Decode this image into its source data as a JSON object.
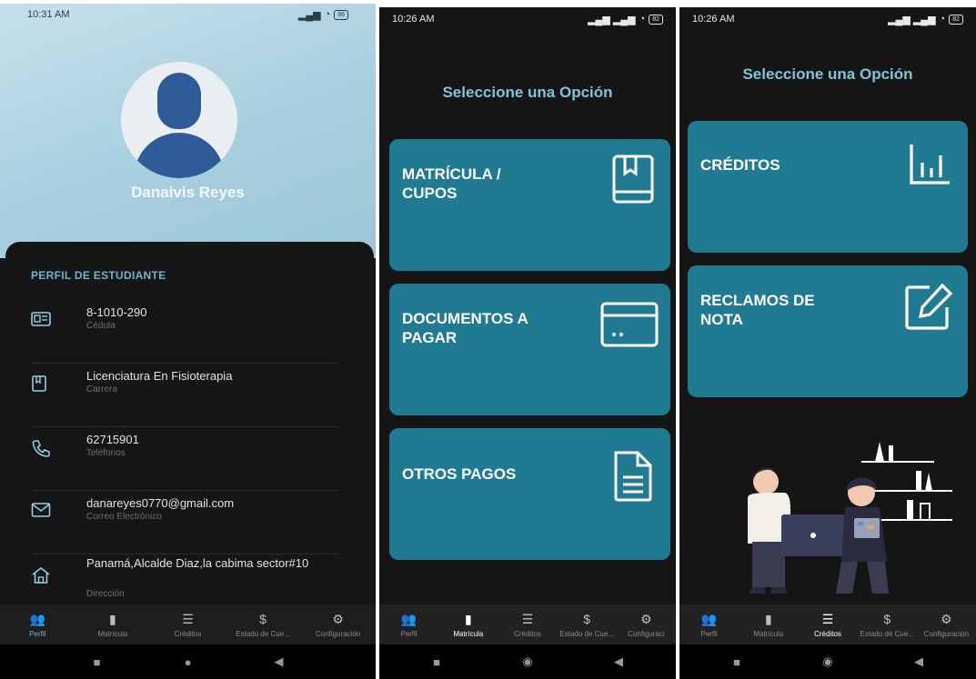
{
  "profile": {
    "status_time": "10:31 AM",
    "status_battery": "86",
    "name": "Danaivis Reyes",
    "section_title": "PERFIL DE ESTUDIANTE",
    "fields": [
      {
        "value": "8-1010-290",
        "label": "Cédula",
        "icon": "id-card-icon"
      },
      {
        "value": "Licenciatura En Fisioterapia",
        "label": "Carrera",
        "icon": "book-icon"
      },
      {
        "value": "62715901",
        "label": "Teléfonos",
        "icon": "phone-icon"
      },
      {
        "value": "danareyes0770@gmail.com",
        "label": "Correo Electrónico",
        "icon": "envelope-icon"
      },
      {
        "value": "Panamá,Alcalde Diaz,la cabima sector#10",
        "label": "Dirección",
        "icon": "home-icon"
      }
    ],
    "nav": [
      "Perfil",
      "Matrícula",
      "Créditos",
      "Estado de Cue...",
      "Configuración"
    ]
  },
  "matricula": {
    "status_time": "10:26 AM",
    "status_battery": "82",
    "title": "Seleccione una Opción",
    "options": [
      {
        "label": "MATRÍCULA /\nCUPOS",
        "icon": "book-icon"
      },
      {
        "label": "DOCUMENTOS A\nPAGAR",
        "icon": "credit-card-icon"
      },
      {
        "label": "OTROS PAGOS",
        "icon": "document-icon"
      }
    ],
    "nav": [
      "Perfil",
      "Matrícula",
      "Créditos",
      "Estado de Cue...",
      "Configuraci"
    ]
  },
  "creditos": {
    "status_time": "10:26 AM",
    "status_battery": "82",
    "title": "Seleccione una Opción",
    "options": [
      {
        "label": "CRÉDITOS",
        "icon": "bar-chart-icon"
      },
      {
        "label": "RECLAMOS DE\nNOTA",
        "icon": "edit-icon"
      }
    ],
    "nav": [
      "Perfil",
      "Matrícula",
      "Créditos",
      "Estado de Cue...",
      "Configuración"
    ]
  },
  "colors": {
    "accent": "#207a92",
    "title": "#7fc4dc",
    "background": "#151515"
  }
}
